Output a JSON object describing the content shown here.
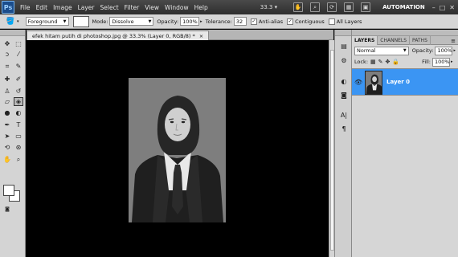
{
  "menubar": {
    "logo": "Ps",
    "items": [
      "File",
      "Edit",
      "Image",
      "Layer",
      "Select",
      "Filter",
      "View",
      "Window",
      "Help"
    ],
    "zoom": "33.3",
    "workspace": "AUTOMATION",
    "window_controls": [
      "–",
      "□",
      "✕"
    ]
  },
  "options": {
    "preset": "Foreground",
    "mode_label": "Mode:",
    "mode_value": "Dissolve",
    "opacity_label": "Opacity:",
    "opacity_value": "100%",
    "tolerance_label": "Tolerance:",
    "tolerance_value": "32",
    "antialias_label": "Anti-alias",
    "contiguous_label": "Contiguous",
    "all_layers_label": "All Layers"
  },
  "document": {
    "tab_title": "efek hitam putih di photoshop.jpg @ 33.3% (Layer 0, RGB/8) *",
    "close": "×"
  },
  "layers_panel": {
    "tabs": [
      "LAYERS",
      "CHANNELS",
      "PATHS"
    ],
    "blend_mode": "Normal",
    "opacity_label": "Opacity:",
    "opacity_value": "100%",
    "lock_label": "Lock:",
    "fill_label": "Fill:",
    "fill_value": "100%",
    "layers": [
      {
        "name": "Layer 0",
        "visible": true,
        "selected": true
      }
    ]
  },
  "colors": {
    "selection_blue": "#3b95f3",
    "foreground": "#ffffff",
    "background": "#ffffff",
    "canvas_bg": "#000000"
  }
}
